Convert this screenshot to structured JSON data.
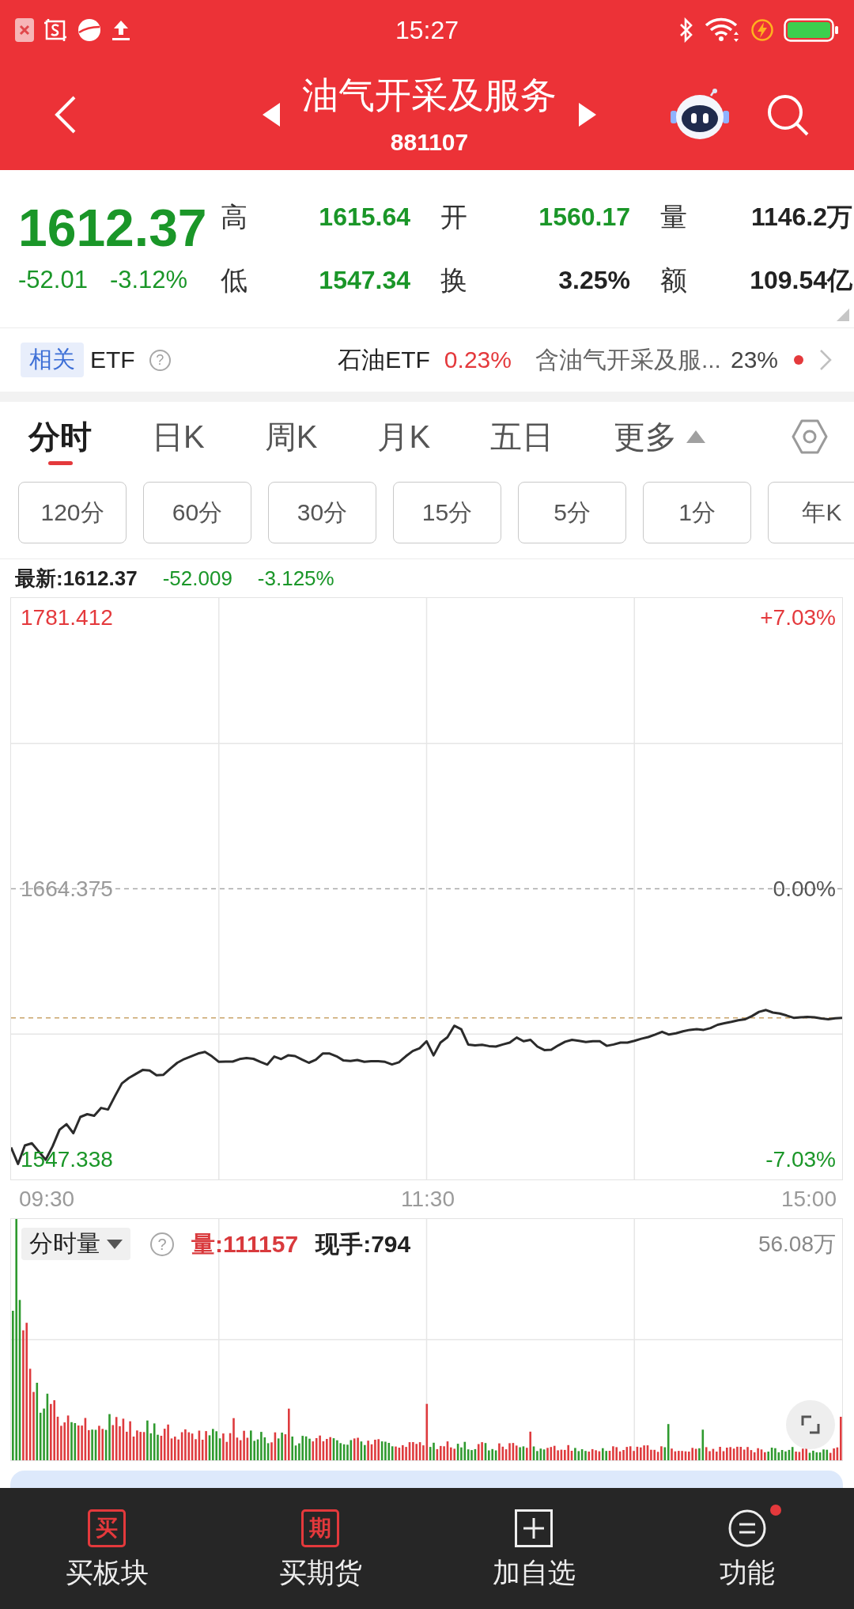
{
  "status_bar": {
    "time": "15:27"
  },
  "header": {
    "title": "油气开采及服务",
    "code": "881107"
  },
  "quote": {
    "price": "1612.37",
    "change": "-52.01",
    "change_pct": "-3.12%",
    "falling": true,
    "stats": [
      {
        "label": "高",
        "value": "1615.64",
        "color": "#1a9628"
      },
      {
        "label": "开",
        "value": "1560.17",
        "color": "#1a9628"
      },
      {
        "label": "量",
        "value": "1146.2万",
        "color": "#222222"
      },
      {
        "label": "低",
        "value": "1547.34",
        "color": "#1a9628"
      },
      {
        "label": "换",
        "value": "3.25%",
        "color": "#222222"
      },
      {
        "label": "额",
        "value": "109.54亿",
        "color": "#222222"
      }
    ]
  },
  "related_etf": {
    "tag": "相关",
    "label": "ETF",
    "help": "?",
    "fund_name": "石油ETF",
    "fund_change": "0.23%",
    "fund_rising": true,
    "holding_text": "含油气开采及服...",
    "holding_pct": "23%",
    "notice_dot": true
  },
  "chart_tabs": [
    {
      "label": "分时",
      "selected": true,
      "kind": "tab"
    },
    {
      "label": "日K",
      "selected": false,
      "kind": "tab"
    },
    {
      "label": "周K",
      "selected": false,
      "kind": "tab"
    },
    {
      "label": "月K",
      "selected": false,
      "kind": "tab"
    },
    {
      "label": "五日",
      "selected": false,
      "kind": "tab"
    },
    {
      "label": "更多",
      "selected": false,
      "kind": "menu"
    }
  ],
  "periods": [
    {
      "label": "120分",
      "selected": false
    },
    {
      "label": "60分",
      "selected": false
    },
    {
      "label": "30分",
      "selected": false
    },
    {
      "label": "15分",
      "selected": false
    },
    {
      "label": "5分",
      "selected": false
    },
    {
      "label": "1分",
      "selected": false
    },
    {
      "label": "年K",
      "selected": false
    }
  ],
  "latest": {
    "price_text": "最新:1612.37",
    "change": "-52.009",
    "change_pct": "-3.125%",
    "falling": true
  },
  "price_chart": {
    "percent_labels": [
      "+7.03%",
      "0.00%",
      "-7.03%"
    ],
    "time_labels": [
      "09:30",
      "11:30",
      "15:00"
    ],
    "chart_data": {
      "type": "line",
      "categories": [
        null,
        null,
        null,
        null,
        null,
        null,
        null,
        null,
        null,
        null,
        null,
        null,
        null,
        null,
        null,
        null,
        null,
        null,
        null,
        null,
        null,
        null,
        null,
        null,
        null,
        null,
        null,
        null,
        null,
        null,
        null,
        null,
        null,
        null,
        null,
        null,
        null,
        null,
        null,
        null,
        null,
        null,
        null,
        null,
        null,
        null,
        null,
        null,
        null,
        null,
        null,
        null,
        null,
        null,
        null,
        null,
        null,
        null,
        null,
        null,
        null,
        null,
        null,
        null,
        null,
        null,
        null,
        null,
        null,
        null,
        null,
        null,
        null,
        null,
        null,
        null,
        null,
        null,
        null,
        null,
        null,
        null,
        null,
        null,
        null,
        null,
        null,
        null,
        null,
        null,
        null,
        null,
        null,
        null,
        null,
        null,
        null,
        null,
        null,
        null,
        null,
        null,
        null,
        null,
        null,
        null,
        null,
        null,
        null,
        null,
        null,
        null,
        null,
        null,
        null,
        null,
        null,
        null,
        null,
        null,
        null
      ],
      "values": [
        1552.6,
        1545.5,
        1553.5,
        1554.4,
        1550.9,
        1547.3,
        1553.2,
        1560.3,
        1562.7,
        1558.8,
        1565.8,
        1567.0,
        1566.3,
        1569.7,
        1569.0,
        1574.8,
        1580.3,
        1582.6,
        1584.4,
        1586.1,
        1585.9,
        1583.8,
        1584.0,
        1586.7,
        1589.2,
        1590.8,
        1592.0,
        1593.2,
        1593.9,
        1592.0,
        1589.6,
        1589.7,
        1589.7,
        1590.8,
        1591.3,
        1590.9,
        1589.6,
        1588.4,
        1591.9,
        1590.8,
        1592.4,
        1592.1,
        1590.6,
        1589.2,
        1590.5,
        1593.2,
        1593.2,
        1592.0,
        1590.2,
        1590.0,
        1590.4,
        1589.6,
        1589.9,
        1589.9,
        1589.6,
        1588.5,
        1589.4,
        1592.0,
        1594.3,
        1595.5,
        1598.5,
        1592.4,
        1597.9,
        1600.2,
        1605.2,
        1603.7,
        1597.1,
        1596.7,
        1597.0,
        1596.4,
        1596.2,
        1597.1,
        1597.9,
        1600.1,
        1598.5,
        1599.1,
        1596.2,
        1594.7,
        1594.8,
        1596.7,
        1598.3,
        1599.1,
        1598.7,
        1598.2,
        1598.5,
        1598.5,
        1596.5,
        1597.1,
        1597.9,
        1597.9,
        1598.7,
        1599.6,
        1600.3,
        1601.4,
        1602.6,
        1601.4,
        1601.9,
        1602.8,
        1603.4,
        1603.7,
        1603.4,
        1604.2,
        1605.6,
        1606.3,
        1606.9,
        1607.6,
        1608.0,
        1609.4,
        1611.2,
        1612.0,
        1610.9,
        1610.5,
        1609.6,
        1608.6,
        1608.9,
        1609.0,
        1608.8,
        1608.3,
        1608.0,
        1608.4,
        1608.6
      ],
      "ylim": [
        1538.8,
        1789.955
      ],
      "yticks": [
        1781.412,
        1664.375,
        1547.338
      ],
      "grid": true,
      "ref_lines": [
        {
          "axis": "y",
          "value": 1664.375,
          "color": "#a8a8a8"
        },
        {
          "axis": "y",
          "value": 1608.6,
          "color": "#c9a46a"
        }
      ]
    }
  },
  "volume_chart": {
    "selector": "分时量",
    "help": "?",
    "volume_text": "量:111157",
    "hand_text": "现手:794",
    "max_label": "56.08万"
  },
  "bottom_nav": [
    {
      "label": "买板块",
      "kind": "glyph",
      "glyph": "买",
      "badge": false
    },
    {
      "label": "买期货",
      "kind": "glyph",
      "glyph": "期",
      "badge": false
    },
    {
      "label": "加自选",
      "kind": "add",
      "badge": false
    },
    {
      "label": "功能",
      "kind": "menu",
      "badge": true
    }
  ]
}
